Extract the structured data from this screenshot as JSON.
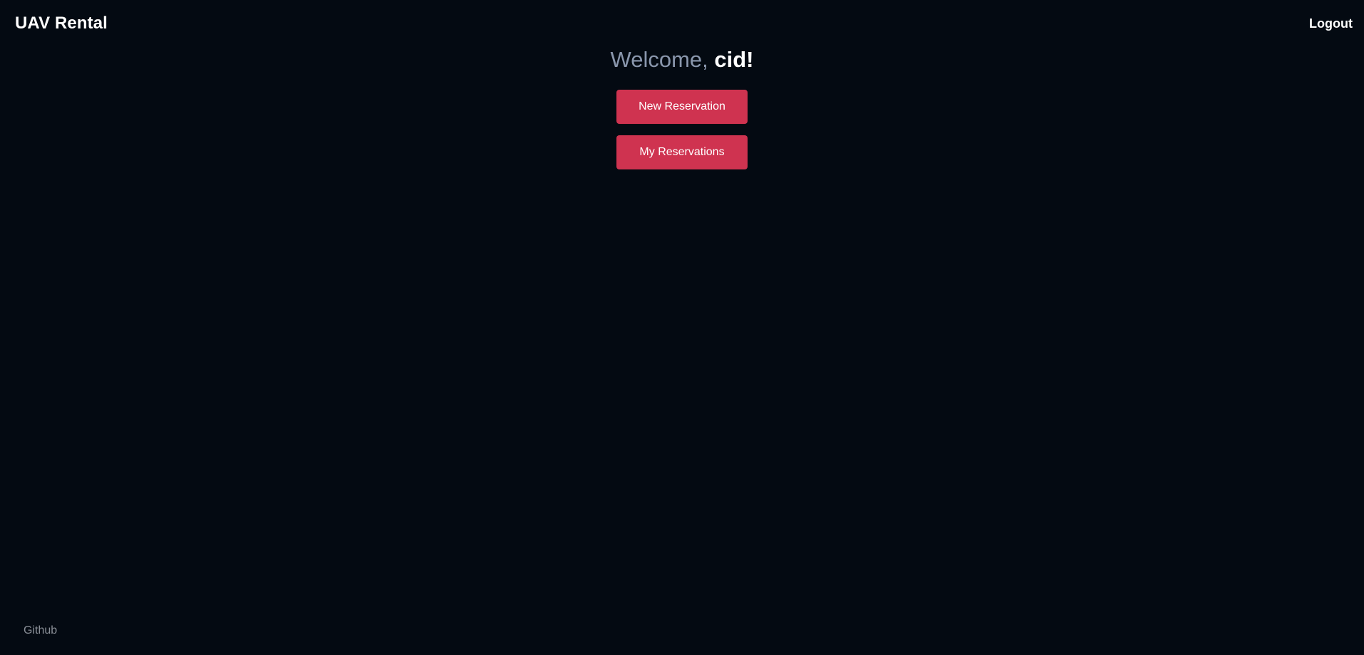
{
  "header": {
    "brand": "UAV Rental",
    "logout_label": "Logout"
  },
  "main": {
    "welcome_prefix": "Welcome, ",
    "username": "cid",
    "welcome_suffix": "!",
    "new_reservation_label": "New Reservation",
    "my_reservations_label": "My Reservations"
  },
  "footer": {
    "github_label": "Github"
  },
  "colors": {
    "background": "#040a12",
    "accent": "#cf3350",
    "muted_text": "#8a97ad"
  }
}
